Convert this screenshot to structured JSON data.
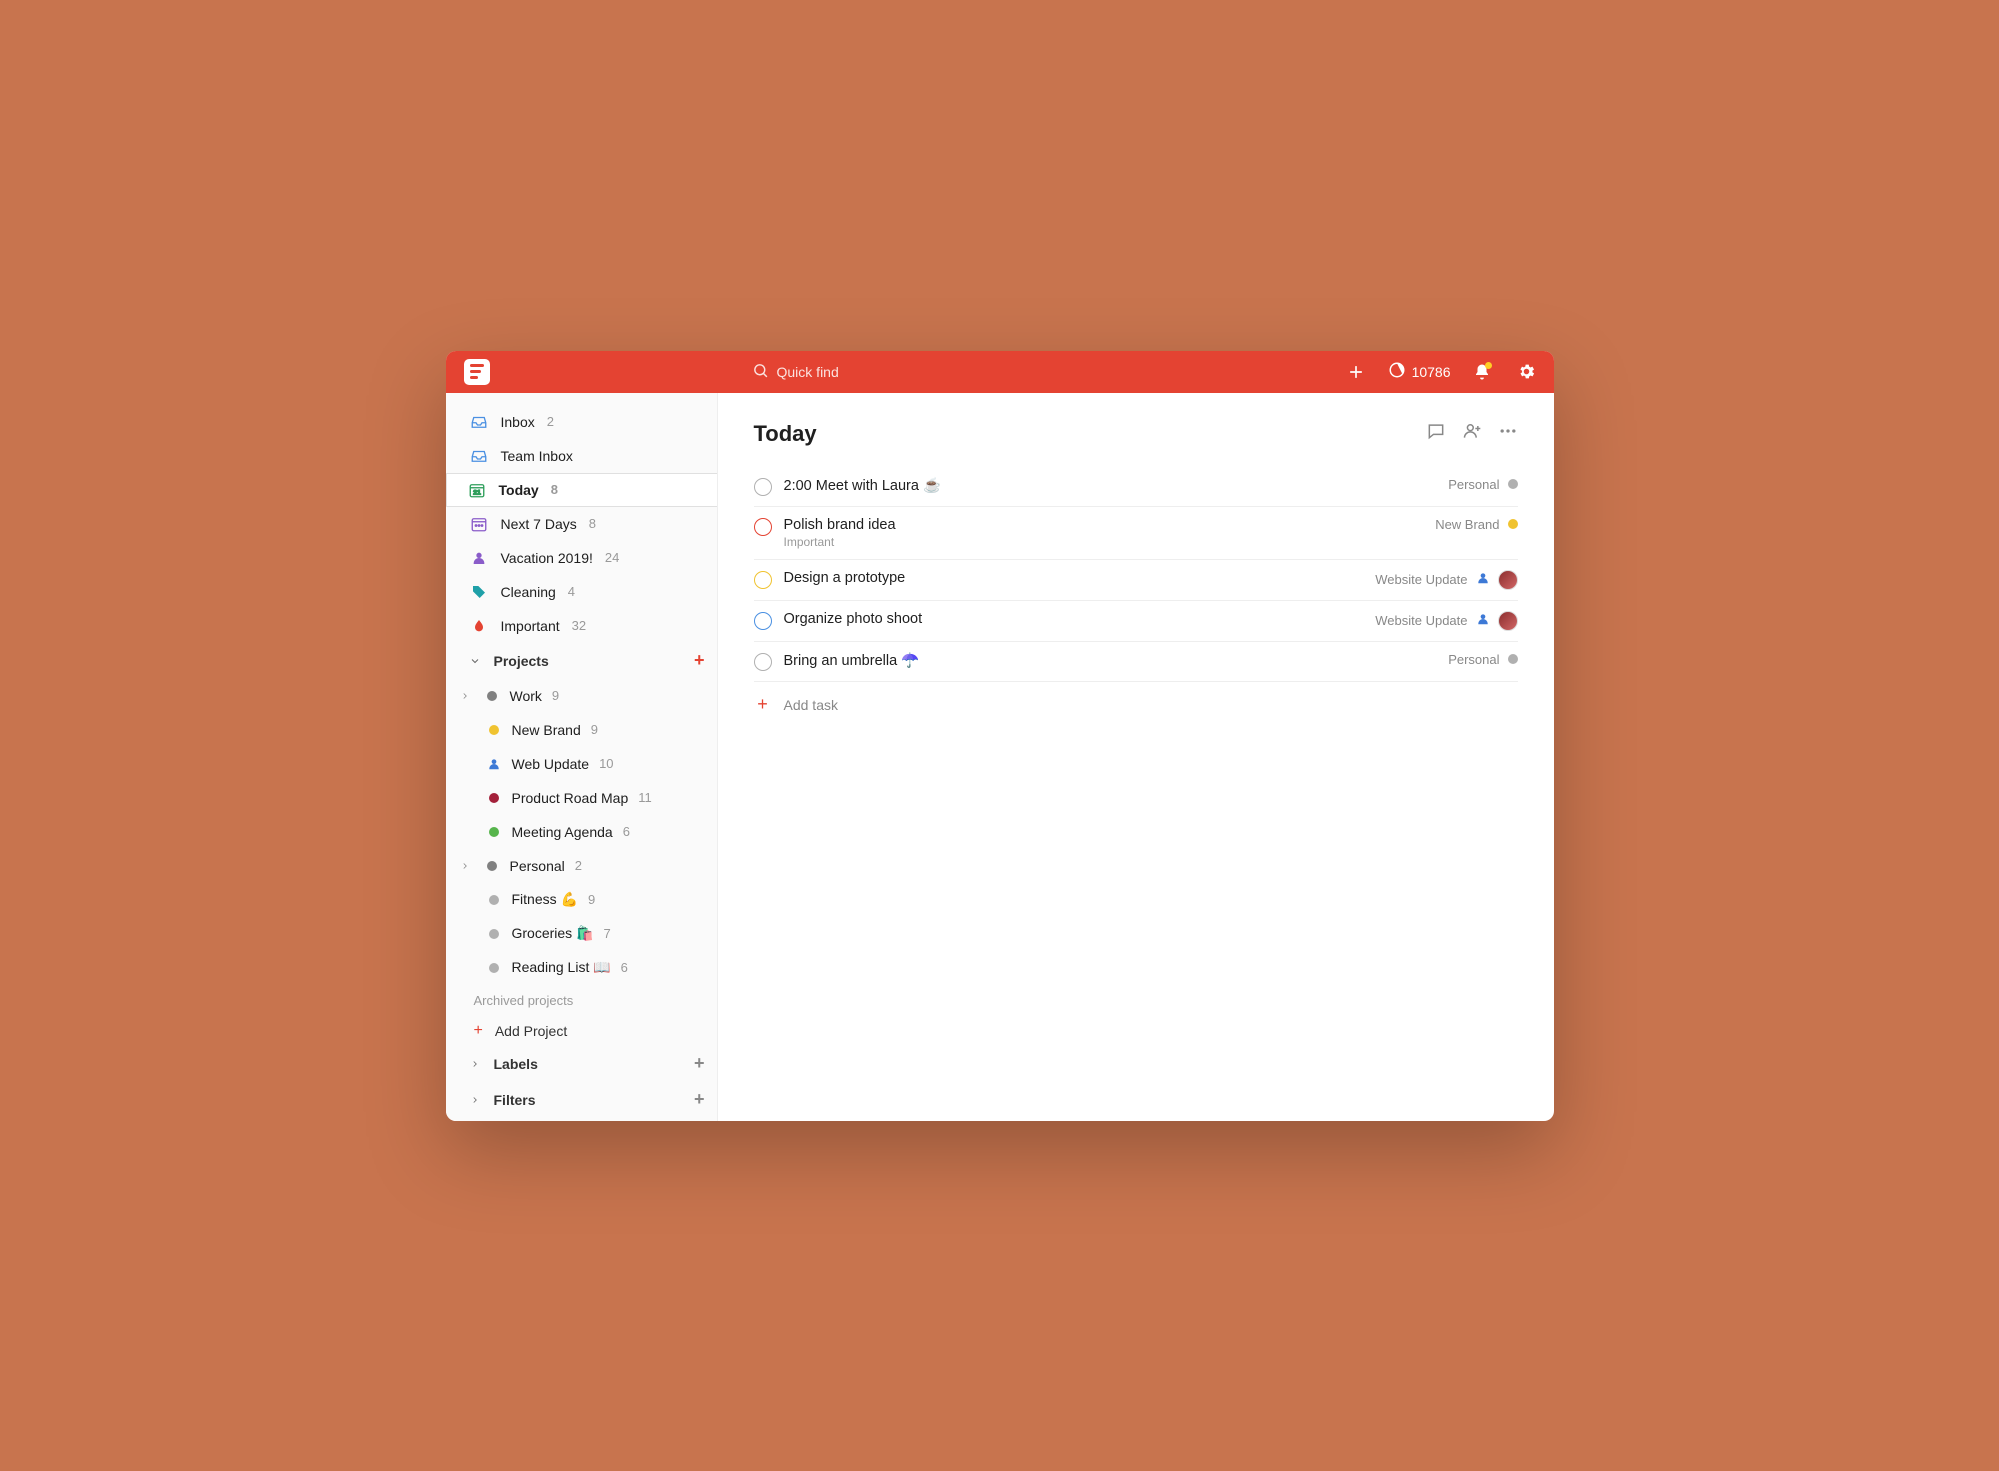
{
  "header": {
    "search_placeholder": "Quick find",
    "karma_score": "10786"
  },
  "sidebar": {
    "nav": [
      {
        "id": "inbox",
        "label": "Inbox",
        "count": "2"
      },
      {
        "id": "team-inbox",
        "label": "Team Inbox",
        "count": ""
      },
      {
        "id": "today",
        "label": "Today",
        "count": "8"
      },
      {
        "id": "next-7-days",
        "label": "Next 7 Days",
        "count": "8"
      },
      {
        "id": "vacation",
        "label": "Vacation 2019!",
        "count": "24"
      },
      {
        "id": "cleaning",
        "label": "Cleaning",
        "count": "4"
      },
      {
        "id": "important",
        "label": "Important",
        "count": "32"
      }
    ],
    "projects_header": "Projects",
    "projects": [
      {
        "id": "work",
        "label": "Work",
        "count": "9",
        "color": "#808080",
        "expandable": true,
        "children": [
          {
            "id": "new-brand",
            "label": "New Brand",
            "count": "9",
            "color": "#f0c330"
          },
          {
            "id": "web-update",
            "label": "Web Update",
            "count": "10",
            "color": "#3d79d6",
            "icon": "user"
          },
          {
            "id": "product-road-map",
            "label": "Product Road Map",
            "count": "11",
            "color": "#a3203a"
          },
          {
            "id": "meeting-agenda",
            "label": "Meeting Agenda",
            "count": "6",
            "color": "#56b44b"
          }
        ]
      },
      {
        "id": "personal",
        "label": "Personal",
        "count": "2",
        "color": "#808080",
        "expandable": true,
        "children": [
          {
            "id": "fitness",
            "label": "Fitness 💪",
            "count": "9",
            "color": "#808080"
          },
          {
            "id": "groceries",
            "label": "Groceries 🛍️",
            "count": "7",
            "color": "#808080"
          },
          {
            "id": "reading-list",
            "label": "Reading List 📖",
            "count": "6",
            "color": "#808080"
          }
        ]
      }
    ],
    "archived_label": "Archived projects",
    "add_project_label": "Add Project",
    "labels_header": "Labels",
    "filters_header": "Filters"
  },
  "main": {
    "title": "Today",
    "add_task_label": "Add task",
    "tasks": [
      {
        "title": "2:00 Meet with Laura ☕",
        "sub": "",
        "project": "Personal",
        "project_color": "#b0b0b0",
        "priority_color": "#b0b0b0",
        "avatar": false
      },
      {
        "title": "Polish brand idea",
        "sub": "Important",
        "project": "New Brand",
        "project_color": "#f0c330",
        "priority_color": "#e44332",
        "avatar": false
      },
      {
        "title": "Design a prototype",
        "sub": "",
        "project": "Website Update",
        "project_color": "user",
        "priority_color": "#f0c330",
        "avatar": true
      },
      {
        "title": "Organize photo shoot",
        "sub": "",
        "project": "Website Update",
        "project_color": "user",
        "priority_color": "#4a90e2",
        "avatar": true
      },
      {
        "title": "Bring an umbrella ☂️",
        "sub": "",
        "project": "Personal",
        "project_color": "#b0b0b0",
        "priority_color": "#b0b0b0",
        "avatar": false
      }
    ]
  }
}
